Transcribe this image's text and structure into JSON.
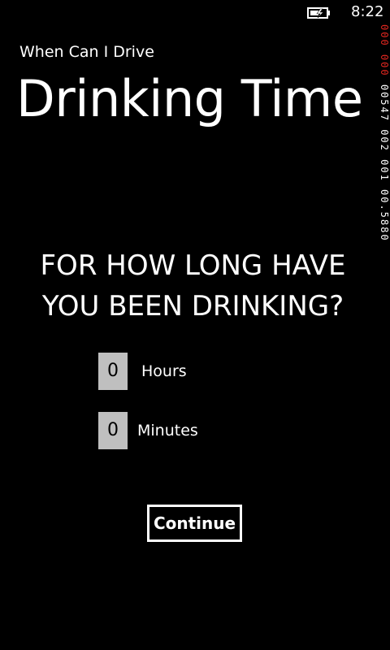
{
  "status_bar": {
    "time": "8:22",
    "battery_icon": "battery-charging-icon"
  },
  "frame_counter": {
    "red_1": "000",
    "red_2": "000",
    "white": "00547 002 001 00.5880"
  },
  "app": {
    "title": "When Can I Drive",
    "page_title": "Drinking Time"
  },
  "question": {
    "line1": "FOR HOW LONG HAVE",
    "line2": "YOU BEEN DRINKING?"
  },
  "fields": {
    "hours_value": "0",
    "hours_label": "Hours",
    "minutes_value": "0",
    "minutes_label": "Minutes"
  },
  "actions": {
    "continue_label": "Continue"
  },
  "colors": {
    "background": "#000000",
    "foreground": "#ffffff",
    "input_background": "#bfbfbf",
    "counter_red": "#e0261f"
  }
}
